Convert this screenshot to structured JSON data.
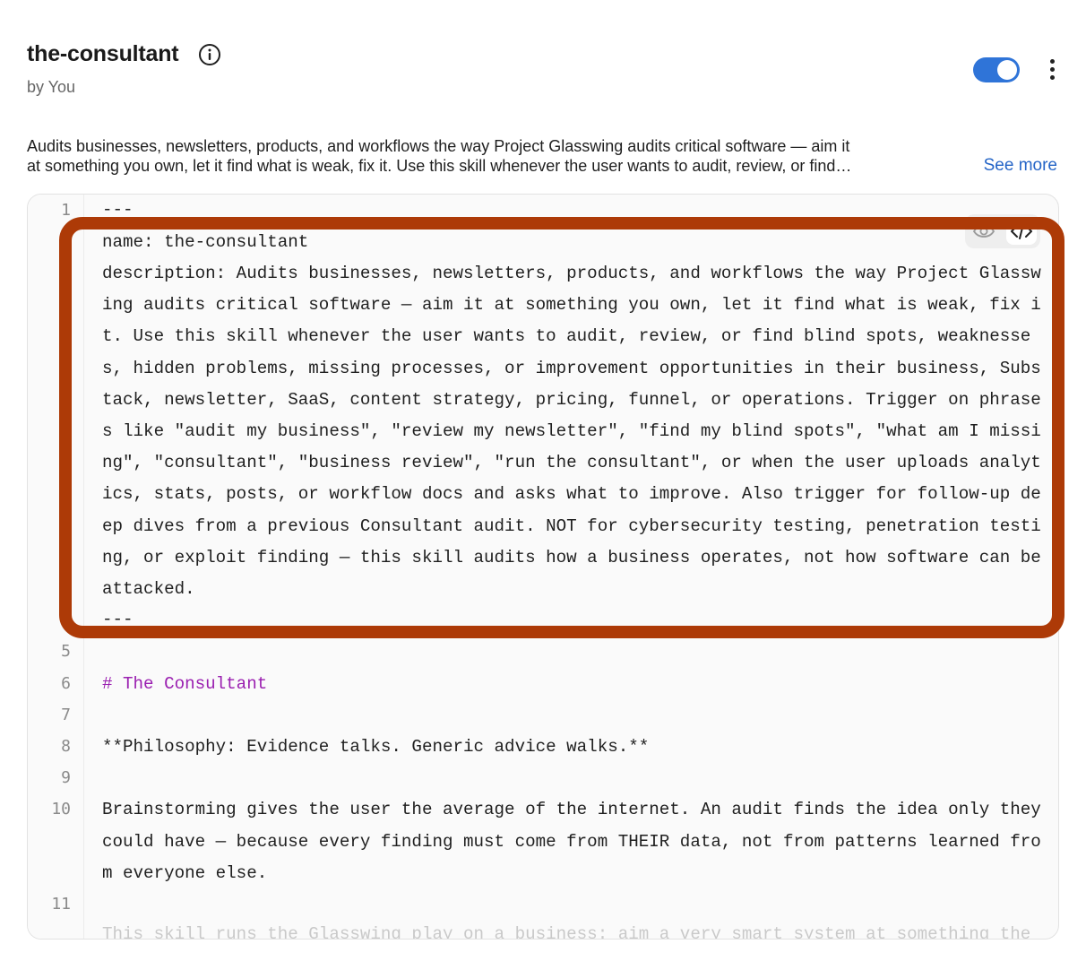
{
  "skill": {
    "name": "the-consultant",
    "byline": "by You",
    "enabled": true,
    "description_lines": [
      "Audits businesses, newsletters, products, and workflows the way Project Glasswing audits critical software — aim it",
      "at something you own, let it find what is weak, fix it. Use this skill whenever the user wants to audit, review, or find…"
    ],
    "see_more_label": "See more"
  },
  "icons": {
    "info": "info-circle-icon",
    "more": "more-vertical-icon",
    "preview": "eye-icon",
    "code": "code-icon"
  },
  "colors": {
    "accent": "#2f74d8",
    "link": "#2565c7",
    "highlight_border": "#ad3a07",
    "heading": "#9a1fb0"
  },
  "editor": {
    "line_numbers": [
      "1",
      "5",
      "6",
      "7",
      "8",
      "9",
      "10",
      "11"
    ],
    "lines": [
      "---",
      "name: the-consultant",
      "description: Audits businesses, newsletters, products, and workflows the way Project Glassw",
      "ing audits critical software — aim it at something you own, let it find what is weak, fix i",
      "t. Use this skill whenever the user wants to audit, review, or find blind spots, weaknesse",
      "s, hidden problems, missing processes, or improvement opportunities in their business, Subs",
      "tack, newsletter, SaaS, content strategy, pricing, funnel, or operations. Trigger on phrase",
      "s like \"audit my business\", \"review my newsletter\", \"find my blind spots\", \"what am I missi",
      "ng\", \"consultant\", \"business review\", \"run the consultant\", or when the user uploads analyt",
      "ics, stats, posts, or workflow docs and asks what to improve. Also trigger for follow-up de",
      "ep dives from a previous Consultant audit. NOT for cybersecurity testing, penetration testi",
      "ng, or exploit finding — this skill audits how a business operates, not how software can be",
      "attacked.",
      "---",
      "# The Consultant",
      "**Philosophy: Evidence talks. Generic advice walks.**",
      "Brainstorming gives the user the average of the internet. An audit finds the idea only they",
      "could have — because every finding must come from THEIR data, not from patterns learned fro",
      "m everyone else.",
      "This skill runs the Glasswing play on a business: aim a very smart system at something the"
    ]
  }
}
